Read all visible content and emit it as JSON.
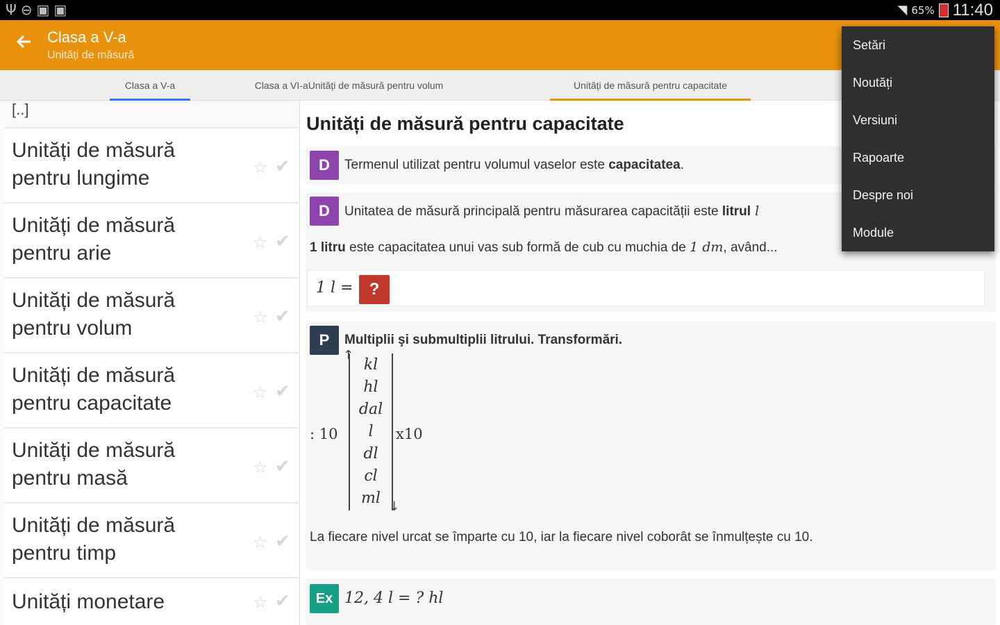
{
  "status_bar": {
    "battery_percent": "65%",
    "time": "11:40",
    "icons": [
      "usb-icon",
      "dnd-icon",
      "photo-icon",
      "photo-icon",
      "wifi-icon",
      "battery-icon"
    ]
  },
  "toolbar": {
    "title": "Clasa a V-a",
    "subtitle": "Unități de măsură",
    "back_icon": "arrow-left-icon",
    "color": "#e8910c"
  },
  "tabs": [
    {
      "label": "Clasa a V-a"
    },
    {
      "label": "Clasa a VI-aUnități de măsură pentru volum"
    },
    {
      "label": "Unități de măsură pentru capacitate"
    }
  ],
  "sidebar": {
    "ellipsis": "[..]",
    "items": [
      {
        "label": "Unități de măsură pentru lungime"
      },
      {
        "label": "Unități de măsură pentru arie"
      },
      {
        "label": "Unități de măsură pentru volum"
      },
      {
        "label": "Unități de măsură pentru capacitate"
      },
      {
        "label": "Unități de măsură pentru masă"
      },
      {
        "label": "Unități de măsură pentru timp"
      },
      {
        "label": "Unități monetare"
      }
    ]
  },
  "content": {
    "heading": "Unități de măsură pentru capacitate",
    "def1": {
      "badge": "D",
      "text": "Termenul utilizat pentru volumul vaselor este ",
      "bold": "capacitatea",
      "tail": "."
    },
    "def2": {
      "badge": "D",
      "text": "Unitatea de măsură principală pentru măsurarea capacității este ",
      "bold": "litrul",
      "tail": " l"
    },
    "def2_line": {
      "bold": "1 litru",
      "text": " este capacitatea unui vas sub formă de cub cu muchia de ",
      "math": "1 dm",
      "tail": ", având..."
    },
    "formula": "1 l =",
    "question_mark": "?",
    "prop": {
      "badge": "P",
      "text": "Multiplii şi submultiplii litrului. Transformări."
    },
    "units": [
      "kl",
      "hl",
      "dal",
      "l",
      "dl",
      "cl",
      "ml"
    ],
    "divide_label": ": 10",
    "multiply_label": "x10",
    "rule_text": "La fiecare nivel urcat se împarte cu 10, iar la fiecare nivel coborât se înmulțește cu 10.",
    "example": {
      "badge": "Ex",
      "text": "12, 4 l = ? hl"
    }
  },
  "menu": {
    "items": [
      "Setări",
      "Noutăți",
      "Versiuni",
      "Rapoarte",
      "Despre noi",
      "Module"
    ]
  }
}
